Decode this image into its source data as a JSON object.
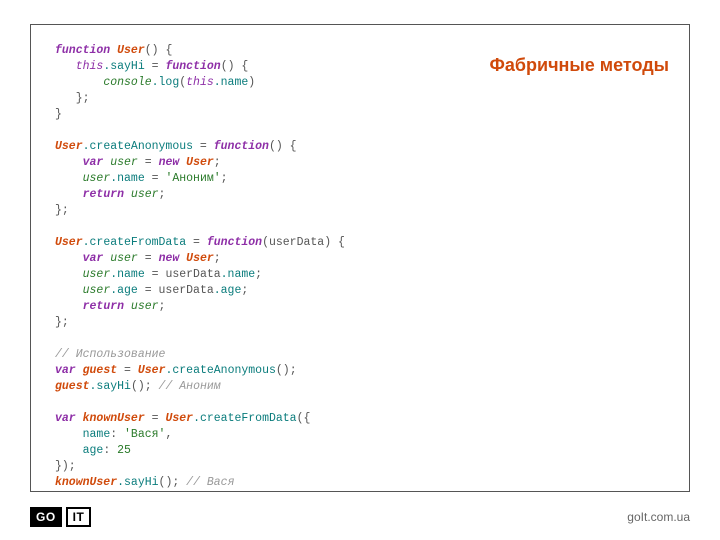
{
  "slide": {
    "title": "Фабричные методы"
  },
  "code": {
    "l1_function": "function",
    "l1_User": "User",
    "l1_rest": "() {",
    "l2_this": "this",
    "l2_sayHi": ".sayHi",
    "l2_eq": " = ",
    "l2_function": "function",
    "l2_rest": "() {",
    "l3_console": "console",
    "l3_log": ".log",
    "l3_open": "(",
    "l3_this": "this",
    "l3_name": ".name",
    "l3_close": ")",
    "l4": "   };",
    "l5": "}",
    "l7_User": "User",
    "l7_createAnonymous": ".createAnonymous",
    "l7_eq": " = ",
    "l7_function": "function",
    "l7_rest": "() {",
    "l8_var": "var",
    "l8_user": " user",
    "l8_eq": " = ",
    "l8_new": "new",
    "l8_User": " User",
    "l8_semi": ";",
    "l9_user": "user",
    "l9_name": ".name",
    "l9_eq": " = ",
    "l9_str": "'Аноним'",
    "l9_semi": ";",
    "l10_return": "return",
    "l10_user": " user",
    "l10_semi": ";",
    "l11": "};",
    "l13_User": "User",
    "l13_createFromData": ".createFromData",
    "l13_eq": " = ",
    "l13_function": "function",
    "l13_rest": "(userData) {",
    "l14_var": "var",
    "l14_user": " user",
    "l14_eq": " = ",
    "l14_new": "new",
    "l14_User": " User",
    "l14_semi": ";",
    "l15_user": "user",
    "l15_name": ".name",
    "l15_eq": " = userData",
    "l15_name2": ".name",
    "l15_semi": ";",
    "l16_user": "user",
    "l16_age": ".age",
    "l16_eq": " = userData",
    "l16_age2": ".age",
    "l16_semi": ";",
    "l17_return": "return",
    "l17_user": " user",
    "l17_semi": ";",
    "l18": "};",
    "l20_cmt": "// Использование",
    "l21_var": "var",
    "l21_guest": " guest",
    "l21_eq": " = ",
    "l21_User": "User",
    "l21_createAnonymous": ".createAnonymous",
    "l21_rest": "();",
    "l22_guest": "guest",
    "l22_sayHi": ".sayHi",
    "l22_call": "();",
    "l22_cmt": " // Аноним",
    "l24_var": "var",
    "l24_knownUser": " knownUser",
    "l24_eq": " = ",
    "l24_User": "User",
    "l24_createFromData": ".createFromData",
    "l24_rest": "({",
    "l25_name": "name",
    "l25_colon": ": ",
    "l25_str": "'Вася'",
    "l25_comma": ",",
    "l26_age": "age",
    "l26_colon": ": ",
    "l26_num": "25",
    "l27": "});",
    "l28_knownUser": "knownUser",
    "l28_sayHi": ".sayHi",
    "l28_call": "();",
    "l28_cmt": " // Вася"
  },
  "footer": {
    "logo_go": "GO",
    "logo_it": "IT",
    "site": "goIt.com.ua"
  }
}
